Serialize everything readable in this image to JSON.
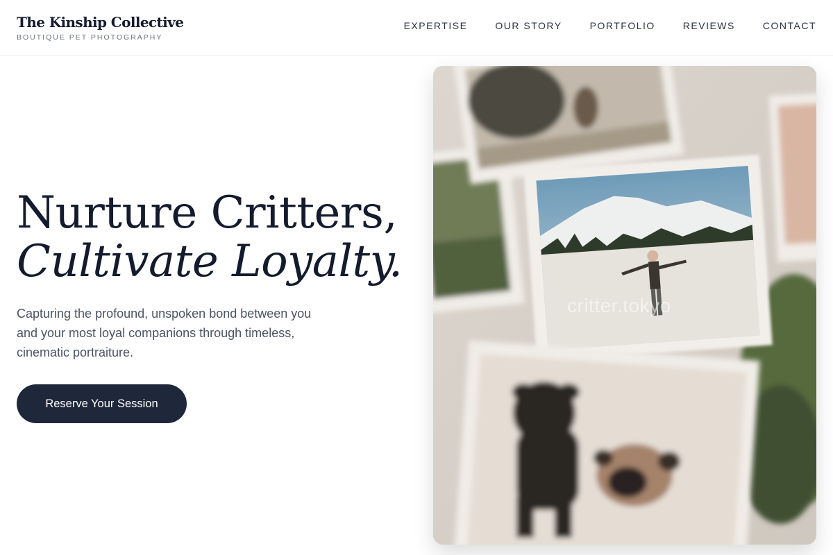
{
  "brand": {
    "name": "The Kinship Collective",
    "tagline": "BOUTIQUE PET PHOTOGRAPHY"
  },
  "nav": {
    "items": [
      {
        "label": "EXPERTISE"
      },
      {
        "label": "OUR STORY"
      },
      {
        "label": "PORTFOLIO"
      },
      {
        "label": "REVIEWS"
      },
      {
        "label": "CONTACT"
      }
    ]
  },
  "hero": {
    "title_line1": "Nurture Critters,",
    "title_line2": "Cultivate Loyalty.",
    "description": "Capturing the profound, unspoken bond between you and your most loyal companions through timeless, cinematic portraiture.",
    "cta_label": "Reserve Your Session",
    "image_watermark": "critter.tokyo"
  },
  "colors": {
    "primary_dark": "#1f283b",
    "heading": "#141b2e",
    "body_text": "#4a5263",
    "background": "#ffffff"
  }
}
